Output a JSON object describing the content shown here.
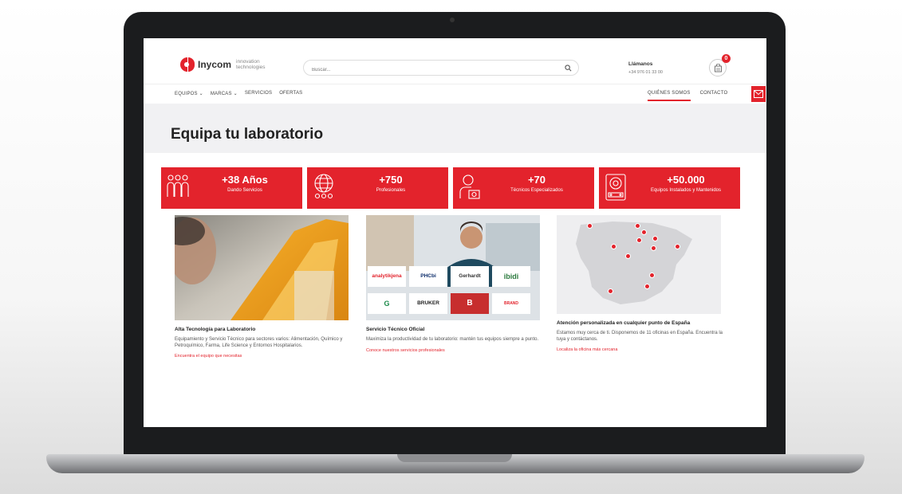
{
  "logo": {
    "name": "Inycom",
    "tagline": "innovation technologies"
  },
  "search": {
    "placeholder": "Buscar..."
  },
  "call": {
    "title": "Llámanos",
    "phone": "+34 976 01 33 00"
  },
  "cart": {
    "count": "0"
  },
  "nav": {
    "left": [
      "EQUIPOS ⌄",
      "MARCAS ⌄",
      "SERVICIOS",
      "OFERTAS"
    ],
    "right": [
      "QUIÉNES SOMOS",
      "CONTACTO"
    ]
  },
  "hero": {
    "title": "Equipa tu laboratorio"
  },
  "stats": [
    {
      "value": "+38 Años",
      "label": "Dando Servicios"
    },
    {
      "value": "+750",
      "label": "Profesionales"
    },
    {
      "value": "+70",
      "label": "Técnicos Especializados"
    },
    {
      "value": "+50.000",
      "label": "Equipos Instalados y Mantenidos"
    }
  ],
  "cards": [
    {
      "title": "Alta Tecnología para Laboratorio",
      "text": "Equipamiento y Servicio Técnico para sectores varios: Alimentación, Químico y Petroquímico, Farma, Life Science y Entornos Hospitalarios.",
      "link": "Encuentra el equipo que necesitas"
    },
    {
      "title": "Servicio Técnico Oficial",
      "text": "Maximiza la productividad de tu laboratorio: mantén tus equipos siempre a punto.",
      "link": "Conoce nuestros servicios profesionales"
    },
    {
      "title": "Atención personalizada en cualquier punto de España",
      "text": "Estamos muy cerca de ti. Disponemos de 11 oficinas en España. Encuentra la tuya y contáctanos.",
      "link": "Localiza la oficina más cercana"
    }
  ],
  "brands": [
    "analytikjena",
    "PHCbi",
    "Gerhardt",
    "ibidi",
    "G",
    "BRUKER",
    "B",
    "BRAND"
  ],
  "colors": {
    "accent": "#e3232c",
    "hero_bg": "#f1f1f3"
  }
}
